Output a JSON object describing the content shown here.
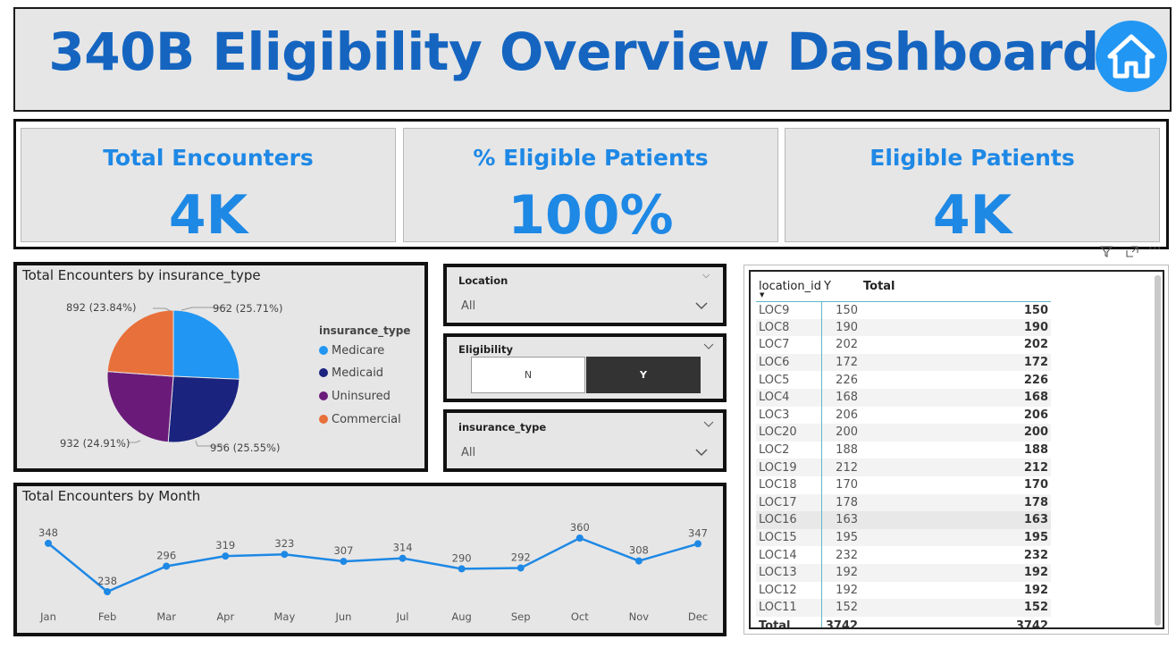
{
  "header": {
    "title": "340B Eligibility Overview Dashboard",
    "home_icon": "home-icon",
    "home_color": "#2196f3",
    "title_color": "#1565c0"
  },
  "kpis": [
    {
      "label": "Total Encounters",
      "value": "4K"
    },
    {
      "label": "% Eligible Patients",
      "value": "100%"
    },
    {
      "label": "Eligible Patients",
      "value": "4K"
    }
  ],
  "pie": {
    "title": "Total Encounters by insurance_type",
    "legend_title": "insurance_type",
    "labels": {
      "medicare": "962 (25.71%)",
      "medicaid": "956 (25.55%)",
      "uninsured": "932 (24.91%)",
      "commercial": "892 (23.84%)"
    },
    "legend": [
      "Medicare",
      "Medicaid",
      "Uninsured",
      "Commercial"
    ]
  },
  "slicers": {
    "location": {
      "title": "Location",
      "value": "All"
    },
    "eligibility": {
      "title": "Eligibility",
      "options": [
        "N",
        "Y"
      ],
      "selected": "Y"
    },
    "insurance": {
      "title": "insurance_type",
      "value": "All"
    }
  },
  "line": {
    "title": "Total Encounters by Month"
  },
  "table": {
    "headers": [
      "location_id",
      "Y",
      "Total"
    ],
    "rows": [
      [
        "LOC9",
        "150",
        "150"
      ],
      [
        "LOC8",
        "190",
        "190"
      ],
      [
        "LOC7",
        "202",
        "202"
      ],
      [
        "LOC6",
        "172",
        "172"
      ],
      [
        "LOC5",
        "226",
        "226"
      ],
      [
        "LOC4",
        "168",
        "168"
      ],
      [
        "LOC3",
        "206",
        "206"
      ],
      [
        "LOC20",
        "200",
        "200"
      ],
      [
        "LOC2",
        "188",
        "188"
      ],
      [
        "LOC19",
        "212",
        "212"
      ],
      [
        "LOC18",
        "170",
        "170"
      ],
      [
        "LOC17",
        "178",
        "178"
      ],
      [
        "LOC16",
        "163",
        "163"
      ],
      [
        "LOC15",
        "195",
        "195"
      ],
      [
        "LOC14",
        "232",
        "232"
      ],
      [
        "LOC13",
        "192",
        "192"
      ],
      [
        "LOC12",
        "192",
        "192"
      ],
      [
        "LOC11",
        "152",
        "152"
      ]
    ],
    "total": [
      "Total",
      "3742",
      "3742"
    ],
    "toolbar_icons": [
      "filter-icon",
      "focus-mode-icon",
      "more-options-icon"
    ]
  },
  "chart_data": [
    {
      "type": "pie",
      "title": "Total Encounters by insurance_type",
      "legend_title": "insurance_type",
      "legend_position": "right",
      "slices": [
        {
          "name": "Medicare",
          "value": 962,
          "percent": 25.71,
          "color": "#2196f3"
        },
        {
          "name": "Medicaid",
          "value": 956,
          "percent": 25.55,
          "color": "#1a237e"
        },
        {
          "name": "Uninsured",
          "value": 932,
          "percent": 24.91,
          "color": "#6a1b7a"
        },
        {
          "name": "Commercial",
          "value": 892,
          "percent": 23.84,
          "color": "#e8703a"
        }
      ]
    },
    {
      "type": "line",
      "title": "Total Encounters by Month",
      "categories": [
        "Jan",
        "Feb",
        "Mar",
        "Apr",
        "May",
        "Jun",
        "Jul",
        "Aug",
        "Sep",
        "Oct",
        "Nov",
        "Dec"
      ],
      "values": [
        348,
        238,
        296,
        319,
        323,
        307,
        314,
        290,
        292,
        360,
        308,
        347
      ],
      "data_labels": true,
      "color": "#1e88e5",
      "ylim": [
        200,
        380
      ]
    }
  ]
}
